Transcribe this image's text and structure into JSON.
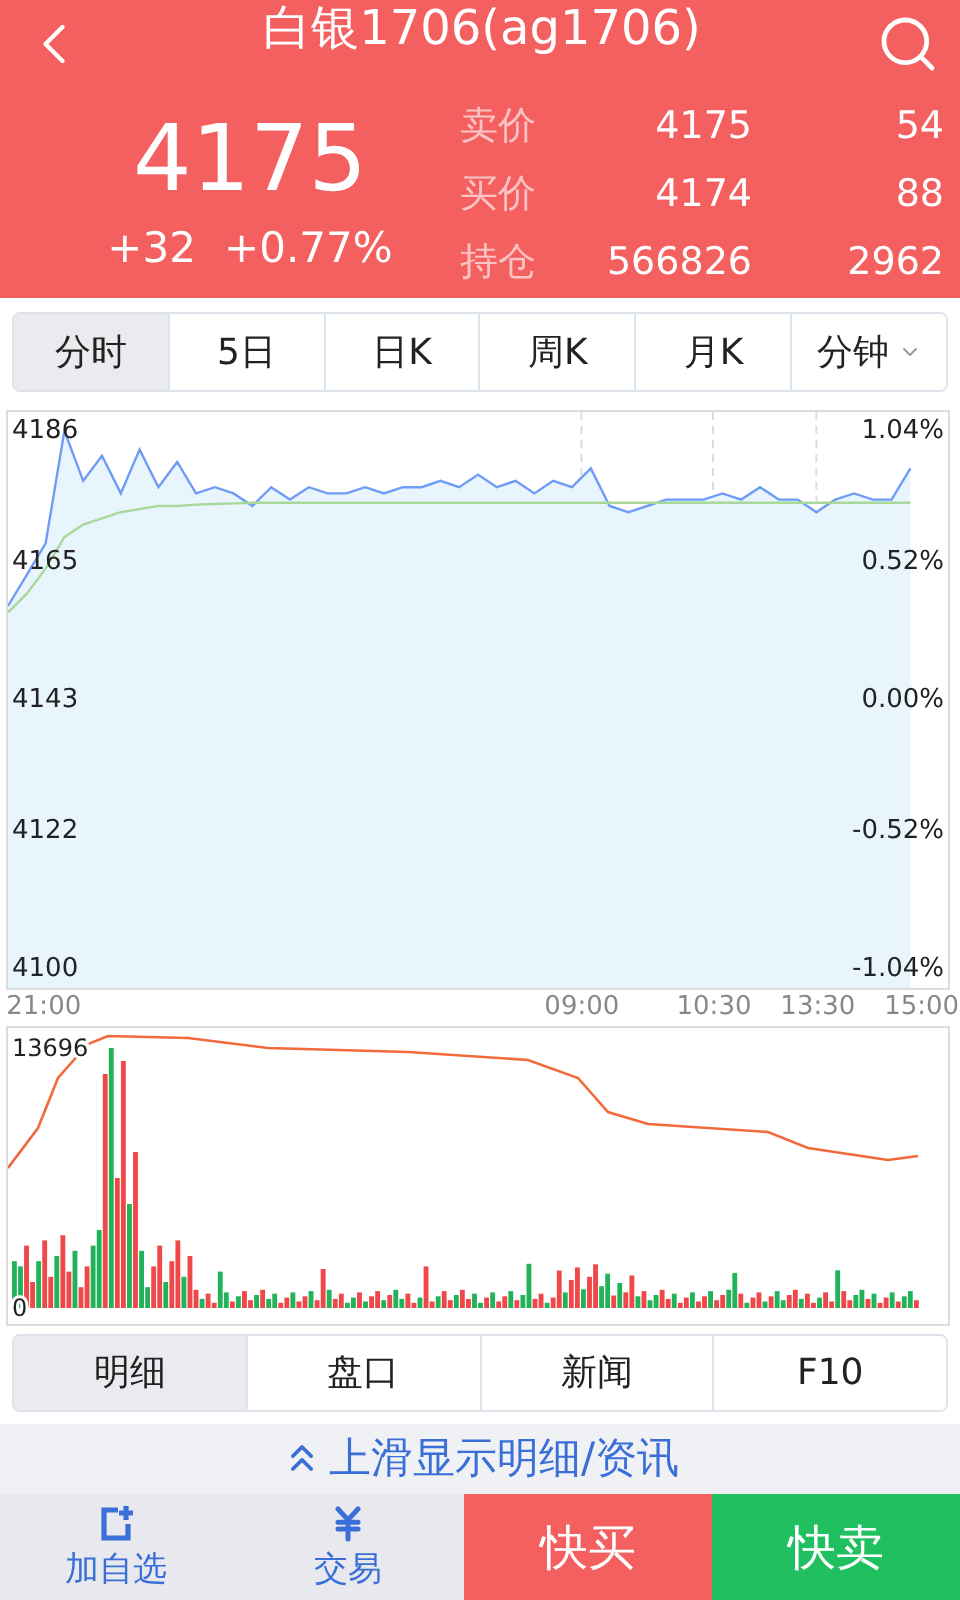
{
  "header": {
    "title": "白银1706(ag1706)"
  },
  "quote": {
    "price": "4175",
    "change": "+32",
    "change_pct": "+0.77%",
    "rows": [
      {
        "label": "卖价",
        "price": "4175",
        "volume": "54"
      },
      {
        "label": "买价",
        "price": "4174",
        "volume": "88"
      },
      {
        "label": "持仓",
        "price": "566826",
        "volume": "2962"
      }
    ]
  },
  "period_tabs": [
    {
      "label": "分时",
      "selected": true,
      "kind": "tab"
    },
    {
      "label": "5日",
      "selected": false,
      "kind": "tab"
    },
    {
      "label": "日K",
      "selected": false,
      "kind": "tab"
    },
    {
      "label": "周K",
      "selected": false,
      "kind": "tab"
    },
    {
      "label": "月K",
      "selected": false,
      "kind": "tab"
    },
    {
      "label": "分钟",
      "selected": false,
      "kind": "dropdown"
    }
  ],
  "price_chart": {
    "right_labels": [
      "1.04%",
      "0.52%",
      "0.00%",
      "-0.52%",
      "-1.04%"
    ],
    "chart_data": {
      "type": "line",
      "ylim": [
        4097,
        4189
      ],
      "categories": [
        null,
        null,
        null,
        null,
        null,
        null,
        null,
        null,
        null,
        null,
        null,
        null,
        null,
        null,
        null,
        null,
        null,
        null,
        null,
        null,
        null,
        null,
        null,
        null,
        null,
        null,
        null,
        null,
        null,
        null,
        null,
        null,
        null,
        null,
        null,
        null,
        null,
        null,
        null,
        null,
        null,
        null,
        null,
        null,
        null,
        null,
        null,
        null,
        null
      ],
      "yticks": [
        {
          "value": 4186,
          "label": "4186"
        },
        {
          "value": 4165,
          "label": "4165"
        },
        {
          "value": 4143,
          "label": "4143"
        },
        {
          "value": 4122,
          "label": "4122"
        },
        {
          "value": 4100,
          "label": "4100"
        }
      ],
      "series": [
        {
          "color": "#6f9cf5",
          "values": [
            4158,
            4163,
            4168,
            4186,
            4178,
            4182,
            4176,
            4183,
            4177,
            4181,
            4176,
            4177,
            4176,
            4174,
            4177,
            4175,
            4177,
            4176,
            4176,
            4177,
            4176,
            4177,
            4177,
            4178,
            4177,
            4179,
            4177,
            4178,
            4176,
            4178,
            4177,
            4180,
            4174,
            4173,
            4174,
            4175,
            4175,
            4175,
            4176,
            4175,
            4177,
            4175,
            4175,
            4173,
            4175,
            4176,
            4175,
            4175,
            4180
          ]
        },
        {
          "color": "#a8d89a",
          "values": [
            4157,
            4160,
            4164,
            4169,
            4171,
            4172,
            4173,
            4173.5,
            4174,
            4174,
            4174.2,
            4174.3,
            4174.4,
            4174.5,
            4174.5,
            4174.5,
            4174.5,
            4174.5,
            4174.5,
            4174.5,
            4174.5,
            4174.5,
            4174.5,
            4174.5,
            4174.5,
            4174.5,
            4174.5,
            4174.5,
            4174.5,
            4174.5,
            4174.5,
            4174.5,
            4174.5,
            4174.5,
            4174.5,
            4174.5,
            4174.5,
            4174.5,
            4174.5,
            4174.5,
            4174.5,
            4174.5,
            4174.5,
            4174.5,
            4174.5,
            4174.5,
            4174.5,
            4174.5,
            4174.5
          ]
        }
      ]
    }
  },
  "time_labels": [
    "21:00",
    "09:00",
    "10:30",
    "13:30",
    "15:00"
  ],
  "volume_chart": {
    "axis_labels": [
      "13696",
      "0"
    ]
  },
  "detail_tabs": [
    {
      "label": "明细",
      "selected": true
    },
    {
      "label": "盘口",
      "selected": false
    },
    {
      "label": "新闻",
      "selected": false
    },
    {
      "label": "F10",
      "selected": false
    }
  ],
  "swipe_hint": "上滑显示明细/资讯",
  "bottom_bar": {
    "actions": [
      {
        "label": "加自选",
        "kind": "add"
      },
      {
        "label": "交易",
        "kind": "trade"
      }
    ],
    "buttons": [
      {
        "label": "快买",
        "kind": "buy"
      },
      {
        "label": "快卖",
        "kind": "sell"
      }
    ]
  }
}
